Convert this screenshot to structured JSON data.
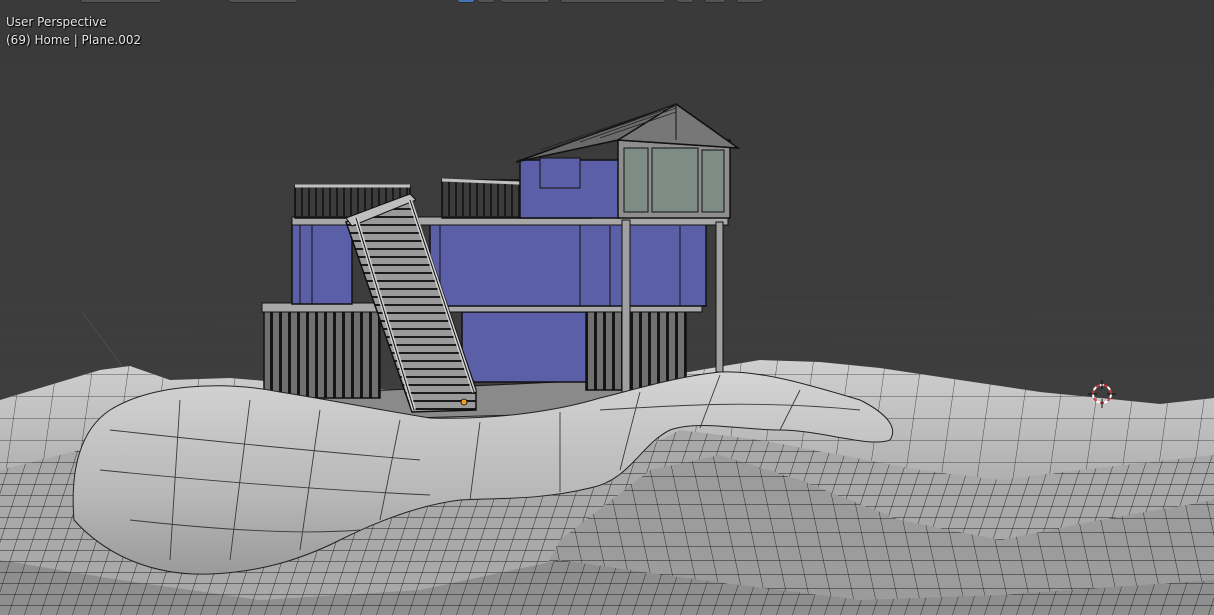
{
  "viewport": {
    "view_name": "User Perspective",
    "object_info": "(69) Home | Plane.002"
  },
  "colors": {
    "background": "#3c3c3c",
    "wall_blue": "#5b5fa8",
    "window_glass": "#7d8c85",
    "terrain": "#b4b4b4",
    "wire": "#1c1c1c",
    "cursor_red": "#d23a3a"
  },
  "icons": [
    "3d-cursor-icon",
    "origin-point-icon"
  ]
}
